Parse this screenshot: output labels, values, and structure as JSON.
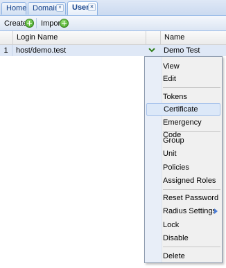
{
  "tabs": [
    {
      "label": "Home",
      "closable": false,
      "active": false
    },
    {
      "label": "Domains",
      "closable": true,
      "active": false
    },
    {
      "label": "User",
      "closable": true,
      "active": true
    }
  ],
  "toolbar": {
    "create_label": "Create",
    "import_label": "Import"
  },
  "grid": {
    "columns": [
      "Login Name",
      "Name"
    ],
    "rows": [
      {
        "index": "1",
        "login": "host/demo.test",
        "name": "Demo Test"
      }
    ]
  },
  "context_menu": {
    "items": [
      "View",
      "Edit",
      "Tokens",
      "Certificate",
      "Emergency Code",
      "Group",
      "Unit",
      "Policies",
      "Assigned Roles",
      "Reset Password",
      "Radius Settings",
      "Lock",
      "Disable",
      "Delete"
    ],
    "hovered": "Certificate",
    "submenu_item": "Radius Settings"
  },
  "colors": {
    "accent": "#15428b",
    "selection": "#dfe8f6",
    "icon_green": "#3c9d1c"
  }
}
